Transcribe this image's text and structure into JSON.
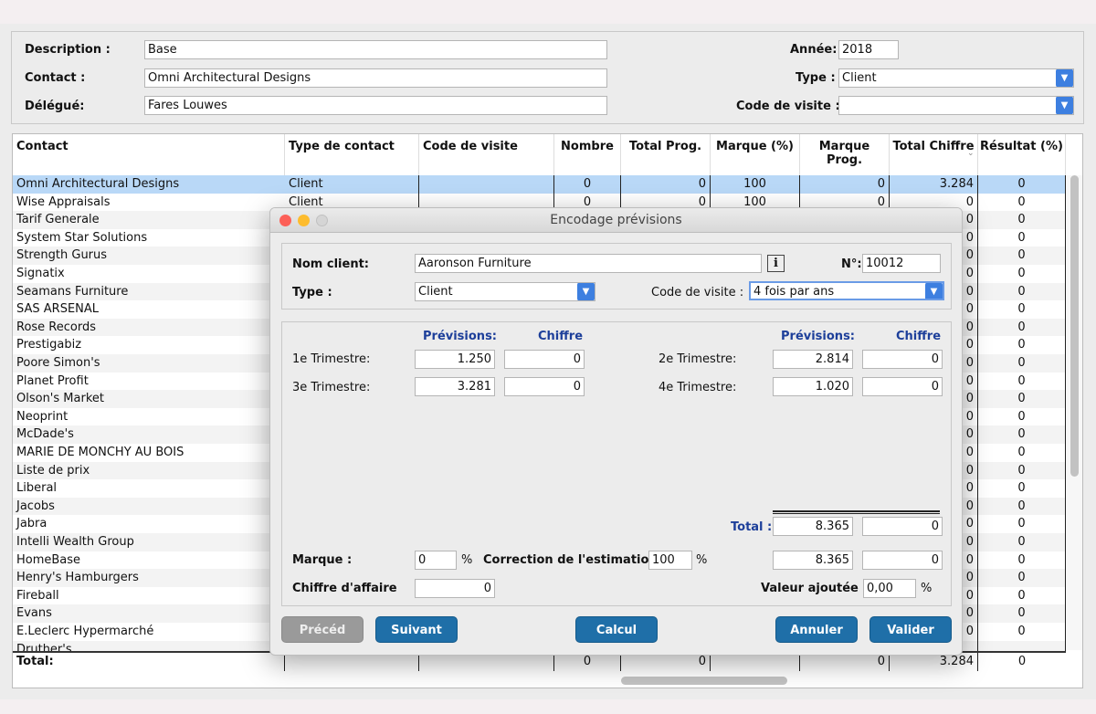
{
  "header": {
    "description_label": "Description :",
    "description_value": "Base",
    "contact_label": "Contact :",
    "contact_value": "Omni Architectural Designs",
    "delegue_label": "Délégué:",
    "delegue_value": "Fares Louwes",
    "annee_label": "Année:",
    "annee_value": "2018",
    "type_label": "Type :",
    "type_value": "Client",
    "code_visite_label": "Code de visite :",
    "code_visite_value": ""
  },
  "table": {
    "columns": [
      "Contact",
      "Type de contact",
      "Code de visite",
      "Nombre",
      "Total Prog.",
      "Marque (%)",
      "Marque Prog.",
      "Total Chiffre",
      "Résultat (%)"
    ],
    "rows": [
      [
        "Omni Architectural Designs",
        "Client",
        "",
        "0",
        "0",
        "100",
        "0",
        "3.284",
        "0"
      ],
      [
        "Wise Appraisals",
        "Client",
        "",
        "0",
        "0",
        "100",
        "0",
        "0",
        "0"
      ],
      [
        "Tarif Generale",
        "",
        "",
        "",
        "",
        "",
        "",
        "0",
        "0"
      ],
      [
        "System Star Solutions",
        "",
        "",
        "",
        "",
        "",
        "",
        "0",
        "0"
      ],
      [
        "Strength Gurus",
        "",
        "",
        "",
        "",
        "",
        "",
        "0",
        "0"
      ],
      [
        "Signatix",
        "",
        "",
        "",
        "",
        "",
        "",
        "0",
        "0"
      ],
      [
        "Seamans Furniture",
        "",
        "",
        "",
        "",
        "",
        "",
        "0",
        "0"
      ],
      [
        "SAS ARSENAL",
        "",
        "",
        "",
        "",
        "",
        "",
        "0",
        "0"
      ],
      [
        "Rose Records",
        "",
        "",
        "",
        "",
        "",
        "",
        "0",
        "0"
      ],
      [
        "Prestigabiz",
        "",
        "",
        "",
        "",
        "",
        "",
        "0",
        "0"
      ],
      [
        "Poore Simon's",
        "",
        "",
        "",
        "",
        "",
        "",
        "0",
        "0"
      ],
      [
        "Planet Profit",
        "",
        "",
        "",
        "",
        "",
        "",
        "0",
        "0"
      ],
      [
        "Olson's Market",
        "",
        "",
        "",
        "",
        "",
        "",
        "0",
        "0"
      ],
      [
        "Neoprint",
        "",
        "",
        "",
        "",
        "",
        "",
        "0",
        "0"
      ],
      [
        "McDade's",
        "",
        "",
        "",
        "",
        "",
        "",
        "0",
        "0"
      ],
      [
        "MARIE DE MONCHY AU BOIS",
        "",
        "",
        "",
        "",
        "",
        "",
        "0",
        "0"
      ],
      [
        "Liste de prix",
        "",
        "",
        "",
        "",
        "",
        "",
        "0",
        "0"
      ],
      [
        "Liberal",
        "",
        "",
        "",
        "",
        "",
        "",
        "0",
        "0"
      ],
      [
        "Jacobs",
        "",
        "",
        "",
        "",
        "",
        "",
        "0",
        "0"
      ],
      [
        "Jabra",
        "",
        "",
        "",
        "",
        "",
        "",
        "0",
        "0"
      ],
      [
        "Intelli Wealth Group",
        "",
        "",
        "",
        "",
        "",
        "",
        "0",
        "0"
      ],
      [
        "HomeBase",
        "",
        "",
        "",
        "",
        "",
        "",
        "0",
        "0"
      ],
      [
        "Henry's Hamburgers",
        "",
        "",
        "",
        "",
        "",
        "",
        "0",
        "0"
      ],
      [
        "Fireball",
        "",
        "",
        "",
        "",
        "",
        "",
        "0",
        "0"
      ],
      [
        "Evans",
        "",
        "",
        "",
        "",
        "",
        "",
        "0",
        "0"
      ],
      [
        "E.Leclerc Hypermarché",
        "",
        "",
        "",
        "",
        "",
        "",
        "0",
        "0"
      ],
      [
        "Druther's",
        "",
        "",
        "",
        "",
        "",
        "",
        "",
        ""
      ]
    ],
    "total": {
      "label": "Total:",
      "nombre": "0",
      "total_prog": "0",
      "marque_prog": "0",
      "total_chiffre": "3.284",
      "resultat": "0"
    }
  },
  "dialog": {
    "title": "Encodage prévisions",
    "nom_client_label": "Nom client:",
    "nom_client_value": "Aaronson Furniture",
    "info_label": "i",
    "numero_label": "N°:",
    "numero_value": "10012",
    "type_label": "Type :",
    "type_value": "Client",
    "code_visite_label": "Code de visite :",
    "code_visite_value": "4 fois par ans",
    "previsions_label": "Prévisions:",
    "chiffre_label": "Chiffre",
    "t1_label": "1e Trimestre:",
    "t1_prev": "1.250",
    "t1_chiffre": "0",
    "t2_label": "2e Trimestre:",
    "t2_prev": "2.814",
    "t2_chiffre": "0",
    "t3_label": "3e Trimestre:",
    "t3_prev": "3.281",
    "t3_chiffre": "0",
    "t4_label": "4e Trimestre:",
    "t4_prev": "1.020",
    "t4_chiffre": "0",
    "total_label": "Total :",
    "total_prev": "8.365",
    "total_chiffre": "0",
    "marque_label": "Marque :",
    "marque_value": "0",
    "pct": "%",
    "correction_label": "Correction de l'estimation",
    "correction_value": "100",
    "corr_prev": "8.365",
    "corr_chiffre": "0",
    "ca_label": "Chiffre d'affaire",
    "ca_value": "0",
    "va_label": "Valeur ajoutée :",
    "va_value": "0,00",
    "buttons": {
      "preced": "Précéd",
      "suivant": "Suivant",
      "calcul": "Calcul",
      "annuler": "Annuler",
      "valider": "Valider"
    }
  },
  "colors": {
    "accent": "#1f6fa8",
    "selection": "#b9d8f7",
    "label_blue": "#1d3f9a"
  }
}
